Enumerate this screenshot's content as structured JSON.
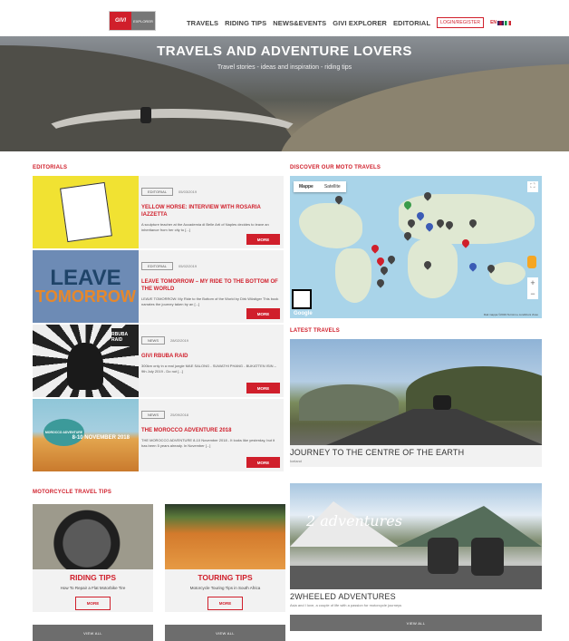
{
  "header": {
    "logo": {
      "left": "GIVI",
      "right": "EXPLORER"
    },
    "nav": [
      "TRAVELS",
      "RIDING TIPS",
      "NEWS&EVENTS",
      "GIVI EXPLORER",
      "EDITORIAL"
    ],
    "login": "LOGIN/REGISTER",
    "lang": "EN"
  },
  "hero": {
    "title": "TRAVELS AND ADVENTURE LOVERS",
    "subtitle": "Travel stories - ideas and inspiration - riding tips"
  },
  "sections": {
    "editorials": "EDITORIALS",
    "map": "DISCOVER OUR MOTO TRAVELS",
    "latest": "LATEST TRAVELS",
    "tips": "MOTORCYCLE TRAVEL TIPS"
  },
  "editorials": [
    {
      "tag": "EDITORIAL",
      "date": "05/03/2019",
      "title": "YELLOW HORSE: INTERVIEW WITH ROSARIA IAZZETTA",
      "text": "A sculpture teacher at the Accademia di Belle Arti of Naples decides to leave an inheritance from her city to [...]",
      "more": "MORE"
    },
    {
      "tag": "EDITORIAL",
      "date": "05/02/2019",
      "title": "LEAVE TOMORROW – MY RIDE TO THE BOTTOM OF THE WORLD",
      "text": "LEAVE TOMORROW: My Ride to the Bottom of the World by Dirk Wüstiger This book narrates the journey taken by an [...]",
      "more": "MORE",
      "image": {
        "line1": "LEAVE",
        "line2": "TOMORROW"
      }
    },
    {
      "tag": "NEWS",
      "date": "28/02/2019",
      "title": "GIVI RBUBA RAID",
      "text": "300km only in a real jungle MAE SALONG - SUWATHI PHANG - BUKATTEN ISIN – 9th July 2019 - Do not [...]",
      "more": "MORE",
      "image": {
        "badge": "RBUBA RAID"
      }
    },
    {
      "tag": "NEWS",
      "date": "25/09/2018",
      "title": "THE MOROCCO ADVENTURE 2018",
      "text": "THE MOROCCO ADVENTURE 8-10 November 2018 - It looks like yesterday, but it has been 5 years already. In November [...]",
      "more": "MORE",
      "image": {
        "medal": "MOROCCO ADVENTURE",
        "dates": "8-10 NOVEMBER 2018"
      }
    }
  ],
  "map": {
    "tabs": [
      "Mappe",
      "Satellite"
    ],
    "google": "Google",
    "footer": "Dati mappa ©2019   Termini e condizioni d'uso"
  },
  "latest": [
    {
      "title": "JOURNEY TO THE CENTRE OF THE EARTH",
      "sub": "Iceland"
    },
    {
      "title": "2WHEELED ADVENTURES",
      "sub": "Asia and I love, a couple of life with a passion for motorcycle journeys",
      "logo": "2 adventures"
    }
  ],
  "tips": [
    {
      "title": "RIDING TIPS",
      "text": "How To Repair a Flat Motorbike Tire",
      "more": "MORE"
    },
    {
      "title": "TOURING TIPS",
      "text": "Motorcycle Touring Tips in South Africa",
      "more": "MORE"
    }
  ],
  "viewall": "VIEW ALL",
  "colors": {
    "accent": "#d01f2b"
  }
}
